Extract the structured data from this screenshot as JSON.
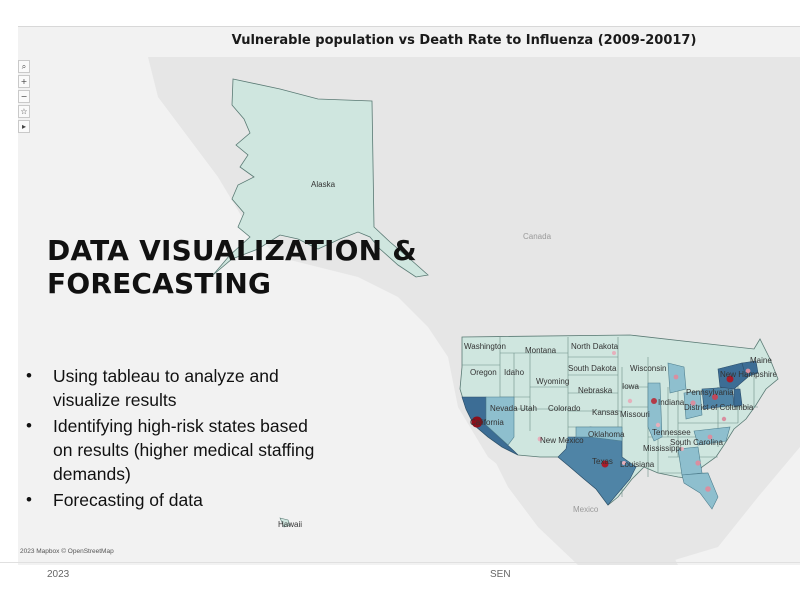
{
  "map": {
    "title": "Vulnerable population vs Death Rate to Influenza (2009-20017)",
    "attribution": "2023 Mapbox © OpenStreetMap",
    "tools": [
      {
        "icon": "search-icon",
        "glyph": "⌕"
      },
      {
        "icon": "zoom-in-icon",
        "glyph": "+"
      },
      {
        "icon": "zoom-out-icon",
        "glyph": "−"
      },
      {
        "icon": "pin-icon",
        "glyph": "☆"
      },
      {
        "icon": "play-icon",
        "glyph": "▸"
      }
    ],
    "background_labels": {
      "canada": "Canada",
      "mexico": "Mexico"
    },
    "colors": {
      "light_fill": "#cfe6df",
      "mid_fill": "#8ebfce",
      "dark_fill": "#4f84a6",
      "darkest_fill": "#3c6d95",
      "dot_small": "#d98fa0",
      "dot_large": "#8b0f1b",
      "land": "#e8e8e8",
      "water": "#ffffff"
    },
    "states": {
      "alaska": "Alaska",
      "hawaii": "Hawaii",
      "washington": "Washington",
      "oregon": "Oregon",
      "idaho": "Idaho",
      "montana": "Montana",
      "wyoming": "Wyoming",
      "nevada": "Nevada",
      "utah": "Utah",
      "colorado": "Colorado",
      "california": "California",
      "new_mexico": "New Mexico",
      "north_dakota": "North Dakota",
      "south_dakota": "South Dakota",
      "nebraska": "Nebraska",
      "kansas": "Kansas",
      "oklahoma": "Oklahoma",
      "texas": "Texas",
      "iowa": "Iowa",
      "missouri": "Missouri",
      "wisconsin": "Wisconsin",
      "indiana": "Indiana",
      "mississippi": "Mississippi",
      "louisiana": "Louisiana",
      "tennessee": "Tennessee",
      "pennsylvania": "Pennsylvania",
      "dc": "District of Columbia",
      "south_carolina": "South Carolina",
      "maine": "Maine",
      "new_hampshire": "New Hampshire"
    }
  },
  "slide": {
    "heading_line1": "DATA VISUALIZATION  &",
    "heading_line2": "FORECASTING",
    "bullets": [
      "Using tableau to analyze and visualize results",
      "Identifying high-risk states based on results (higher medical staffing demands)",
      "Forecasting of data"
    ],
    "footer_year": "2023",
    "footer_mid": "SEN"
  }
}
